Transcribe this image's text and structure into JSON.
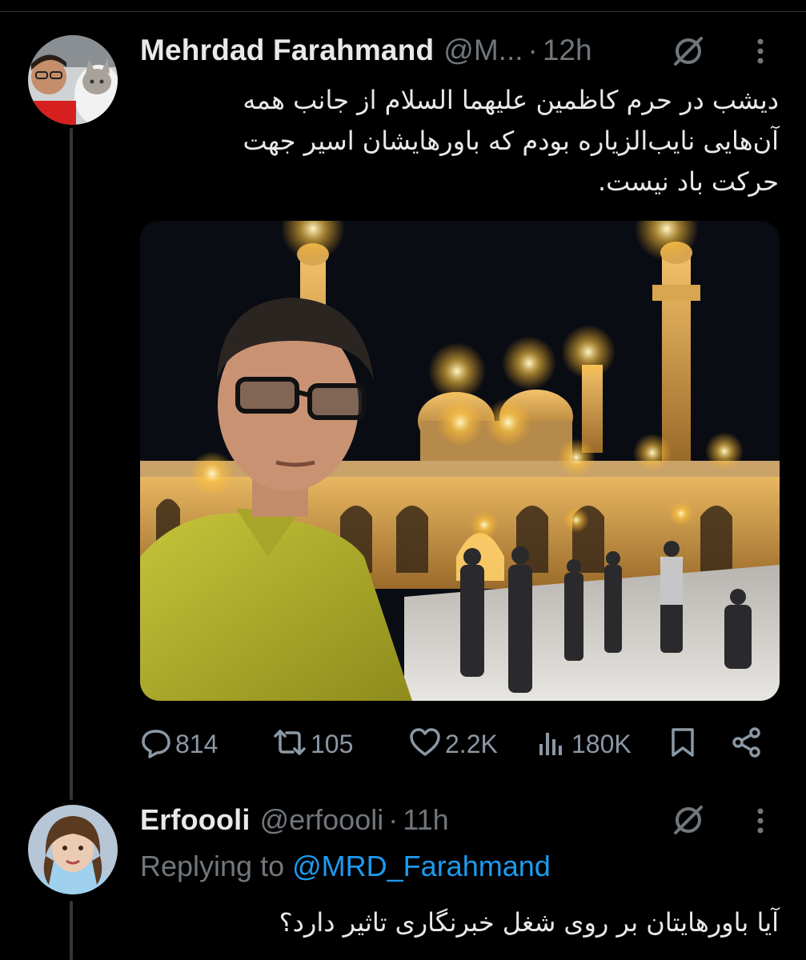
{
  "tweet": {
    "display_name": "Mehrdad Farahmand",
    "handle": "@M...",
    "separator": "·",
    "time": "12h",
    "text": "دیشب در حرم کاظمین علیهما السلام از جانب همه\nآن‌هایی نایب‌الزیاره بودم که باورهایشان اسیر جهت\nحرکت باد نیست.",
    "avatar_icon": "profile-avatar-man-with-cat",
    "media_icon": "photo-selfie-at-shrine-at-night"
  },
  "actions": {
    "replies": "814",
    "reposts": "105",
    "likes": "2.2K",
    "views": "180K"
  },
  "reply": {
    "display_name": "Erfoooli",
    "handle": "@erfoooli",
    "separator": "·",
    "time": "11h",
    "replying_label": "Replying to",
    "replying_to": "@MRD_Farahmand",
    "text": "آیا باورهایتان بر روی شغل خبرنگاری تاثیر دارد؟",
    "avatar_icon": "profile-avatar-child"
  },
  "colors": {
    "background": "#000000",
    "text": "#e7e9ea",
    "secondary": "#71767b",
    "accent": "#1d9bf0",
    "divider": "#2f3336"
  }
}
